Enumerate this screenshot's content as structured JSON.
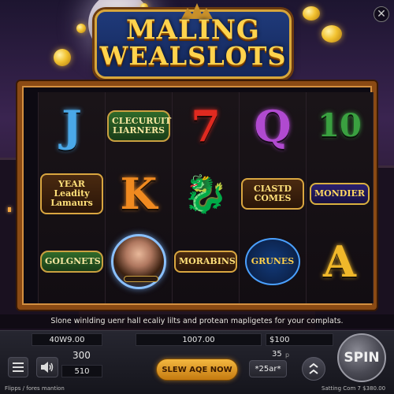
{
  "game": {
    "title_line1": "MALING",
    "title_line2": "WEALSLOTS"
  },
  "reels": [
    {
      "symbols": [
        {
          "type": "letter",
          "text": "J",
          "color": "#4aa8e8"
        },
        {
          "type": "word",
          "style": "badge-gold",
          "text": "YEAR Leadity Lamaurs"
        },
        {
          "type": "word",
          "style": "badge-green",
          "text": "GOLGNETS"
        }
      ]
    },
    {
      "symbols": [
        {
          "type": "word",
          "style": "badge-green",
          "text": "CLECURUIT LIARNERS"
        },
        {
          "type": "letter",
          "text": "K",
          "color": "#f08a20"
        },
        {
          "type": "portrait",
          "text": ""
        }
      ]
    },
    {
      "symbols": [
        {
          "type": "letter",
          "text": "7",
          "color": "#e02a20"
        },
        {
          "type": "icon",
          "name": "blue-dragon-icon",
          "glyph": "🐉"
        },
        {
          "type": "word",
          "style": "badge-gold",
          "text": "MORABINS"
        }
      ]
    },
    {
      "symbols": [
        {
          "type": "letter",
          "text": "Q",
          "color": "#b04ad0"
        },
        {
          "type": "word",
          "style": "badge-gold",
          "text": "CIASTD COMES"
        },
        {
          "type": "word",
          "style": "badge-blue",
          "text": "GRUNES"
        }
      ]
    },
    {
      "symbols": [
        {
          "type": "letter",
          "text": "10",
          "color": "#3aa040"
        },
        {
          "type": "word",
          "style": "badge-purple",
          "text": "MONDIER"
        },
        {
          "type": "letter",
          "text": "A",
          "color": "#f0b82a"
        }
      ]
    }
  ],
  "info_text": "Slone winlding uenr hall ecaliy lilts and protean mapligetes for your complats.",
  "panel": {
    "bet_label": "40W9.00",
    "lines_value": "300",
    "credits_value": "510",
    "balance_value": "1007.00",
    "bet_amount": "$100",
    "level_value": "35",
    "level_suffix": "p",
    "multiplier_value": "*25ar*",
    "buy_button": "SLEW AQE NOW",
    "spin_button": "SPIN"
  },
  "footer": {
    "left": "Flipps / fores mantion",
    "right": "Satting Com 7 $380.00"
  },
  "colors": {
    "accent_gold": "#ffd34d",
    "frame": "#8a4a14",
    "panel_bg": "#1e1e26"
  }
}
